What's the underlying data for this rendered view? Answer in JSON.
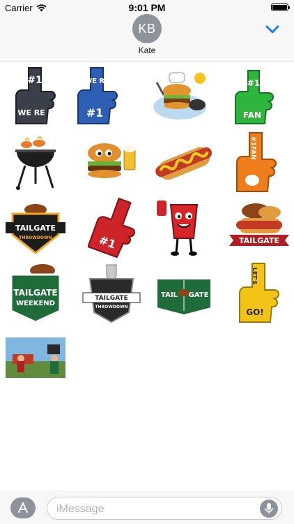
{
  "status_bar": {
    "carrier": "Carrier",
    "time": "9:01 PM"
  },
  "header": {
    "avatar_initials": "KB",
    "contact_name": "Kate"
  },
  "stickers": [
    {
      "name": "foam-finger-we-re-1-dark",
      "text": "WE RE #1"
    },
    {
      "name": "foam-finger-we-re-1-blue",
      "text": "WE RE #1"
    },
    {
      "name": "burger-grill-chef",
      "text": ""
    },
    {
      "name": "foam-finger-1-fan-green",
      "text": "#1 FAN"
    },
    {
      "name": "charcoal-grill",
      "text": ""
    },
    {
      "name": "burger-with-beer",
      "text": ""
    },
    {
      "name": "hot-dog",
      "text": ""
    },
    {
      "name": "foam-finger-1-fan-orange",
      "text": "#1 FAN"
    },
    {
      "name": "tailgate-throwdown-badge",
      "text": "TAILGATE THROWDOWN"
    },
    {
      "name": "foam-finger-1-red",
      "text": "#1"
    },
    {
      "name": "red-cup-mascot",
      "text": ""
    },
    {
      "name": "tailgate-food-banner",
      "text": "TAILGATE"
    },
    {
      "name": "tailgate-weekend-badge",
      "text": "TAILGATE WEEKEND"
    },
    {
      "name": "tailgate-throwdown-trophy-badge",
      "text": "TAILGATE THROWDOWN"
    },
    {
      "name": "tailgate-field-sign",
      "text": "TAIL GATE"
    },
    {
      "name": "foam-finger-let-s-go-yellow",
      "text": "LET'S GO!"
    },
    {
      "name": "tailgate-party-photo",
      "text": ""
    }
  ],
  "input": {
    "placeholder": "iMessage"
  },
  "colors": {
    "ios_blue": "#1a7ef5",
    "gray": "#8e929b",
    "foam_dark": "#3b3f4a",
    "foam_blue": "#2f5fb5",
    "foam_green": "#2db53d",
    "foam_orange": "#f07d1b",
    "foam_red": "#cc2429",
    "foam_yellow": "#f3c417",
    "badge_green": "#1f6b3a"
  }
}
